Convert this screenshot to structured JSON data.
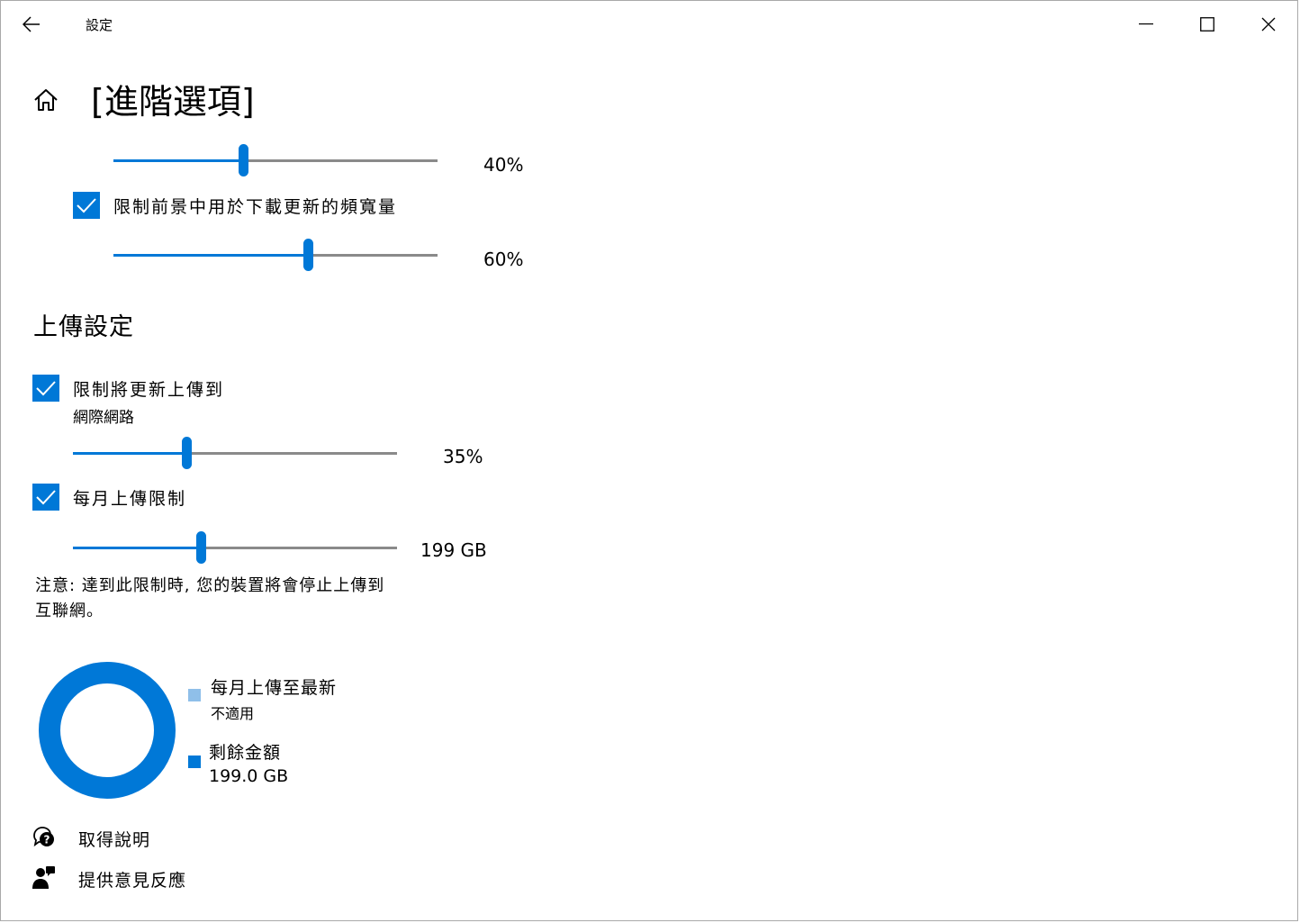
{
  "window": {
    "title": "設定",
    "back_icon": "back-arrow-icon",
    "minimize_icon": "minimize-icon",
    "maximize_icon": "maximize-icon",
    "close_icon": "close-icon"
  },
  "header": {
    "home_icon": "home-icon",
    "title": "[進階選項]"
  },
  "download": {
    "background_slider": {
      "value": 40,
      "value_label": "40%"
    },
    "foreground_checkbox": {
      "checked": true,
      "label": "限制前景中用於下載更新的頻寬量"
    },
    "foreground_slider": {
      "value": 60,
      "value_label": "60%"
    }
  },
  "upload": {
    "section_title": "上傳設定",
    "limit_checkbox": {
      "checked": true,
      "label": "限制將更新上傳到",
      "sublabel": "網際網路"
    },
    "bandwidth_slider": {
      "value": 35,
      "value_label": "35%"
    },
    "monthly_checkbox": {
      "checked": true,
      "label": "每月上傳限制"
    },
    "monthly_slider": {
      "value": 39.5,
      "value_label": "199 GB"
    },
    "note_line1": "注意: 達到此限制時, 您的裝置將會停止上傳到",
    "note_line2": "互聯網。"
  },
  "chart_data": {
    "type": "pie",
    "categories": [
      "每月上傳至最新",
      "剩餘金額"
    ],
    "values": [
      0,
      199.0
    ],
    "colors": [
      "#8fbfe9",
      "#0078d7"
    ],
    "legend": [
      {
        "label": "每月上傳至最新",
        "sub": "不適用",
        "color": "#8fbfe9"
      },
      {
        "label": "剩餘金額",
        "sub": "199.0 GB",
        "color": "#0078d7"
      }
    ]
  },
  "links": {
    "help": {
      "icon": "help-chat-icon",
      "label": "取得說明"
    },
    "feedback": {
      "icon": "feedback-person-icon",
      "label": "提供意見反應"
    }
  },
  "colors": {
    "accent": "#0078d7",
    "track": "#8a8a8a",
    "light_accent": "#8fbfe9"
  }
}
